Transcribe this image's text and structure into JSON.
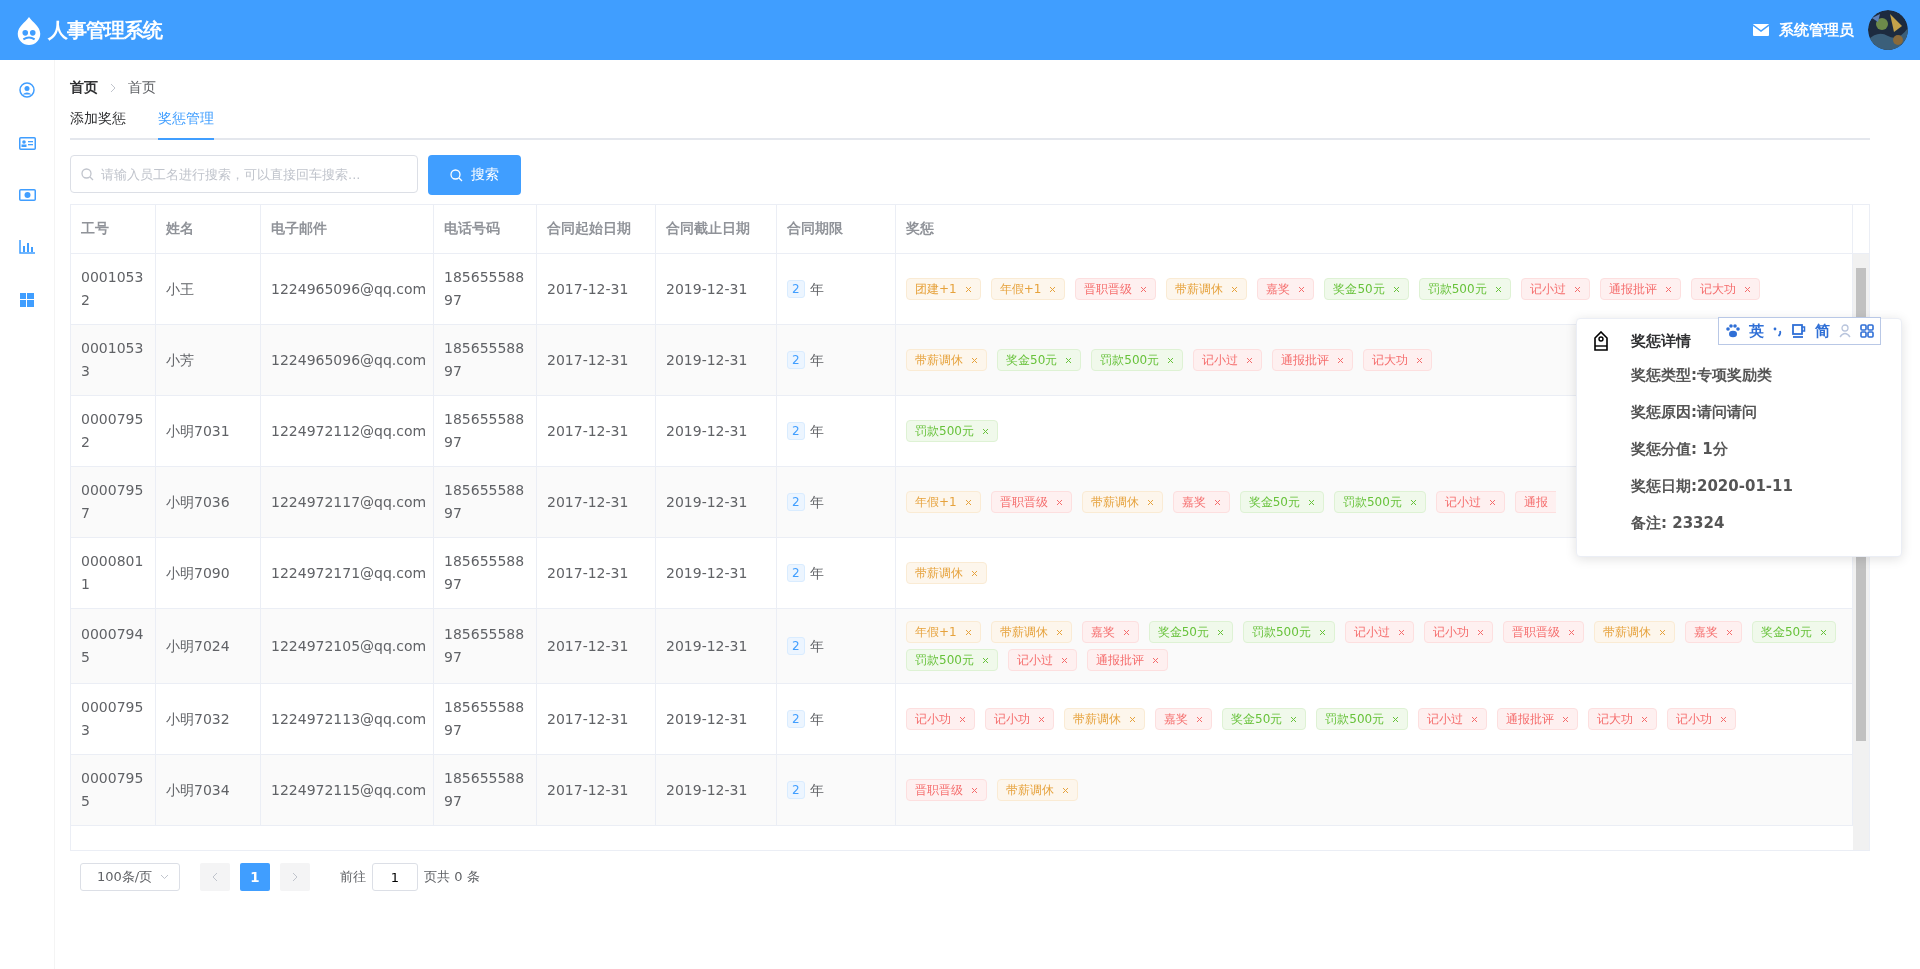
{
  "header": {
    "title": "人事管理系统",
    "user": "系统管理员"
  },
  "sidebar": {
    "items": [
      {
        "kind": "user"
      },
      {
        "kind": "card"
      },
      {
        "kind": "money"
      },
      {
        "kind": "chart"
      },
      {
        "kind": "windows"
      }
    ]
  },
  "breadcrumb": [
    "首页",
    "首页"
  ],
  "tabs": [
    {
      "label": "添加奖惩",
      "selected": false
    },
    {
      "label": "奖惩管理",
      "selected": true
    }
  ],
  "search": {
    "placeholder": "请输入员工名进行搜索，可以直接回车搜索...",
    "button": "搜索"
  },
  "table": {
    "columns": [
      "工号",
      "姓名",
      "电子邮件",
      "电话号码",
      "合同起始日期",
      "合同截止日期",
      "合同期限",
      "奖惩"
    ],
    "rows": [
      {
        "id": "00010532",
        "name": "小王",
        "email": "1224965096@qq.com",
        "phone": "18565558897",
        "start": "2017-12-31",
        "end": "2019-12-31",
        "term": "2",
        "unit": "年",
        "tags": [
          {
            "text": "团建+1",
            "color": "#e6a23c"
          },
          {
            "text": "年假+1",
            "color": "#e6a23c"
          },
          {
            "text": "晋职晋级",
            "color": "#f56c6c"
          },
          {
            "text": "带薪调休",
            "color": "#e6a23c"
          },
          {
            "text": "嘉奖",
            "color": "#f56c6c"
          },
          {
            "text": "奖金50元",
            "color": "#67c23a"
          },
          {
            "text": "罚款500元",
            "color": "#67c23a"
          },
          {
            "text": "记小过",
            "color": "#f56c6c"
          },
          {
            "text": "通报批评",
            "color": "#f56c6c"
          },
          {
            "text": "记大功",
            "color": "#f56c6c"
          }
        ]
      },
      {
        "id": "00010533",
        "name": "小芳",
        "email": "1224965096@qq.com",
        "phone": "18565558897",
        "start": "2017-12-31",
        "end": "2019-12-31",
        "term": "2",
        "unit": "年",
        "tags": [
          {
            "text": "带薪调休",
            "color": "#e6a23c"
          },
          {
            "text": "奖金50元",
            "color": "#67c23a"
          },
          {
            "text": "罚款500元",
            "color": "#67c23a"
          },
          {
            "text": "记小过",
            "color": "#f56c6c"
          },
          {
            "text": "通报批评",
            "color": "#f56c6c"
          },
          {
            "text": "记大功",
            "color": "#f56c6c"
          }
        ]
      },
      {
        "id": "00007952",
        "name": "小明7031",
        "email": "1224972112@qq.com",
        "phone": "18565558897",
        "start": "2017-12-31",
        "end": "2019-12-31",
        "term": "2",
        "unit": "年",
        "tags": [
          {
            "text": "罚款500元",
            "color": "#67c23a"
          }
        ]
      },
      {
        "id": "00007957",
        "name": "小明7036",
        "email": "1224972117@qq.com",
        "phone": "18565558897",
        "start": "2017-12-31",
        "end": "2019-12-31",
        "term": "2",
        "unit": "年",
        "tags": [
          {
            "text": "年假+1",
            "color": "#e6a23c"
          },
          {
            "text": "晋职晋级",
            "color": "#f56c6c"
          },
          {
            "text": "带薪调休",
            "color": "#e6a23c"
          },
          {
            "text": "嘉奖",
            "color": "#f56c6c"
          },
          {
            "text": "奖金50元",
            "color": "#67c23a"
          },
          {
            "text": "罚款500元",
            "color": "#67c23a"
          },
          {
            "text": "记小过",
            "color": "#f56c6c"
          },
          {
            "text": "通报",
            "color": "#f56c6c",
            "cut": true
          }
        ]
      },
      {
        "id": "00008011",
        "name": "小明7090",
        "email": "1224972171@qq.com",
        "phone": "18565558897",
        "start": "2017-12-31",
        "end": "2019-12-31",
        "term": "2",
        "unit": "年",
        "tags": [
          {
            "text": "带薪调休",
            "color": "#e6a23c"
          }
        ]
      },
      {
        "id": "00007945",
        "name": "小明7024",
        "email": "1224972105@qq.com",
        "phone": "18565558897",
        "start": "2017-12-31",
        "end": "2019-12-31",
        "term": "2",
        "unit": "年",
        "tags": [
          {
            "text": "年假+1",
            "color": "#e6a23c"
          },
          {
            "text": "带薪调休",
            "color": "#e6a23c"
          },
          {
            "text": "嘉奖",
            "color": "#f56c6c"
          },
          {
            "text": "奖金50元",
            "color": "#67c23a"
          },
          {
            "text": "罚款500元",
            "color": "#67c23a"
          },
          {
            "text": "记小过",
            "color": "#f56c6c"
          },
          {
            "text": "记小功",
            "color": "#f56c6c"
          },
          {
            "text": "晋职晋级",
            "color": "#f56c6c"
          },
          {
            "text": "带薪调休",
            "color": "#e6a23c"
          },
          {
            "text": "嘉奖",
            "color": "#f56c6c"
          },
          {
            "text": "奖金50元",
            "color": "#67c23a"
          },
          {
            "text": "罚款500元",
            "color": "#67c23a"
          },
          {
            "text": "记小过",
            "color": "#f56c6c"
          },
          {
            "text": "通报批评",
            "color": "#f56c6c"
          }
        ]
      },
      {
        "id": "00007953",
        "name": "小明7032",
        "email": "1224972113@qq.com",
        "phone": "18565558897",
        "start": "2017-12-31",
        "end": "2019-12-31",
        "term": "2",
        "unit": "年",
        "tags": [
          {
            "text": "记小功",
            "color": "#f56c6c"
          },
          {
            "text": "记小功",
            "color": "#f56c6c"
          },
          {
            "text": "带薪调休",
            "color": "#e6a23c"
          },
          {
            "text": "嘉奖",
            "color": "#f56c6c"
          },
          {
            "text": "奖金50元",
            "color": "#67c23a"
          },
          {
            "text": "罚款500元",
            "color": "#67c23a"
          },
          {
            "text": "记小过",
            "color": "#f56c6c"
          },
          {
            "text": "通报批评",
            "color": "#f56c6c"
          },
          {
            "text": "记大功",
            "color": "#f56c6c"
          },
          {
            "text": "记小功",
            "color": "#f56c6c"
          }
        ]
      },
      {
        "id": "00007955",
        "name": "小明7034",
        "email": "1224972115@qq.com",
        "phone": "18565558897",
        "start": "2017-12-31",
        "end": "2019-12-31",
        "term": "2",
        "unit": "年",
        "tags": [
          {
            "text": "晋职晋级",
            "color": "#f56c6c"
          },
          {
            "text": "带薪调休",
            "color": "#e6a23c"
          }
        ]
      }
    ]
  },
  "pagination": {
    "page_size": "100条/页",
    "pages": [
      {
        "label": "1",
        "selected": true
      }
    ],
    "goto_label": "前往",
    "goto_value": "1",
    "total": "页共 0 条"
  },
  "popover": {
    "title": "奖惩详情",
    "lines": [
      "奖惩类型:专项奖励类",
      "奖惩原因:请问请问",
      "奖惩分值: 1分",
      "奖惩日期:2020-01-11",
      "备注: 23324"
    ]
  },
  "ime_bar": {
    "language": "英",
    "script": "简"
  }
}
